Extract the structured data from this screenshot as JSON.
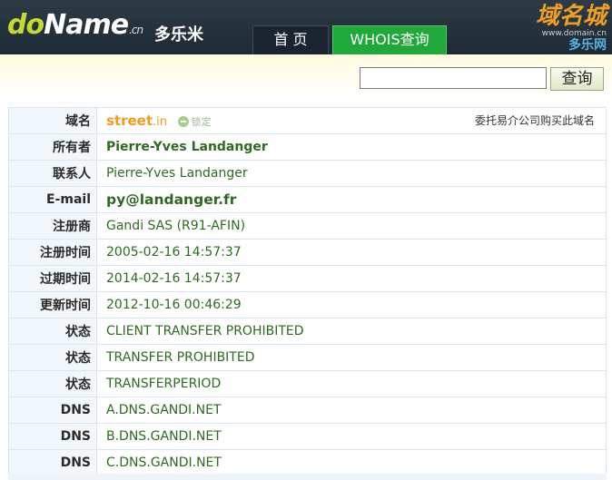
{
  "header": {
    "logo": {
      "part1": "do",
      "part2": "Name",
      "suffix": ".cn"
    },
    "brand_cn": "多乐米",
    "tabs": [
      {
        "label": "首 页"
      },
      {
        "label": "WHOIS查询"
      }
    ],
    "watermark": {
      "title": "域名城",
      "url": "www.domain.cn",
      "sub": "多乐网"
    }
  },
  "search": {
    "input_value": "",
    "button_label": "查询"
  },
  "whois": {
    "domain": {
      "label": "域名",
      "name": "street",
      "tld": ".in",
      "lock_label": "锁定",
      "broker_link": "委托易介公司购买此域名"
    },
    "rows": [
      {
        "label": "所有者",
        "value": "Pierre-Yves Landanger",
        "style": "strong"
      },
      {
        "label": "联系人",
        "value": "Pierre-Yves Landanger",
        "style": ""
      },
      {
        "label": "E-mail",
        "value": "py@landanger.fr",
        "style": "email"
      },
      {
        "label": "注册商",
        "value": "Gandi SAS (R91-AFIN)",
        "style": ""
      },
      {
        "label": "注册时间",
        "value": "2005-02-16 14:57:37",
        "style": ""
      },
      {
        "label": "过期时间",
        "value": "2014-02-16 14:57:37",
        "style": ""
      },
      {
        "label": "更新时间",
        "value": "2012-10-16 00:46:29",
        "style": ""
      },
      {
        "label": "状态",
        "value": "CLIENT TRANSFER PROHIBITED",
        "style": ""
      },
      {
        "label": "状态",
        "value": "TRANSFER PROHIBITED",
        "style": ""
      },
      {
        "label": "状态",
        "value": "TRANSFERPERIOD",
        "style": ""
      },
      {
        "label": "DNS",
        "value": "A.DNS.GANDI.NET",
        "style": ""
      },
      {
        "label": "DNS",
        "value": "B.DNS.GANDI.NET",
        "style": ""
      },
      {
        "label": "DNS",
        "value": "C.DNS.GANDI.NET",
        "style": ""
      }
    ]
  }
}
